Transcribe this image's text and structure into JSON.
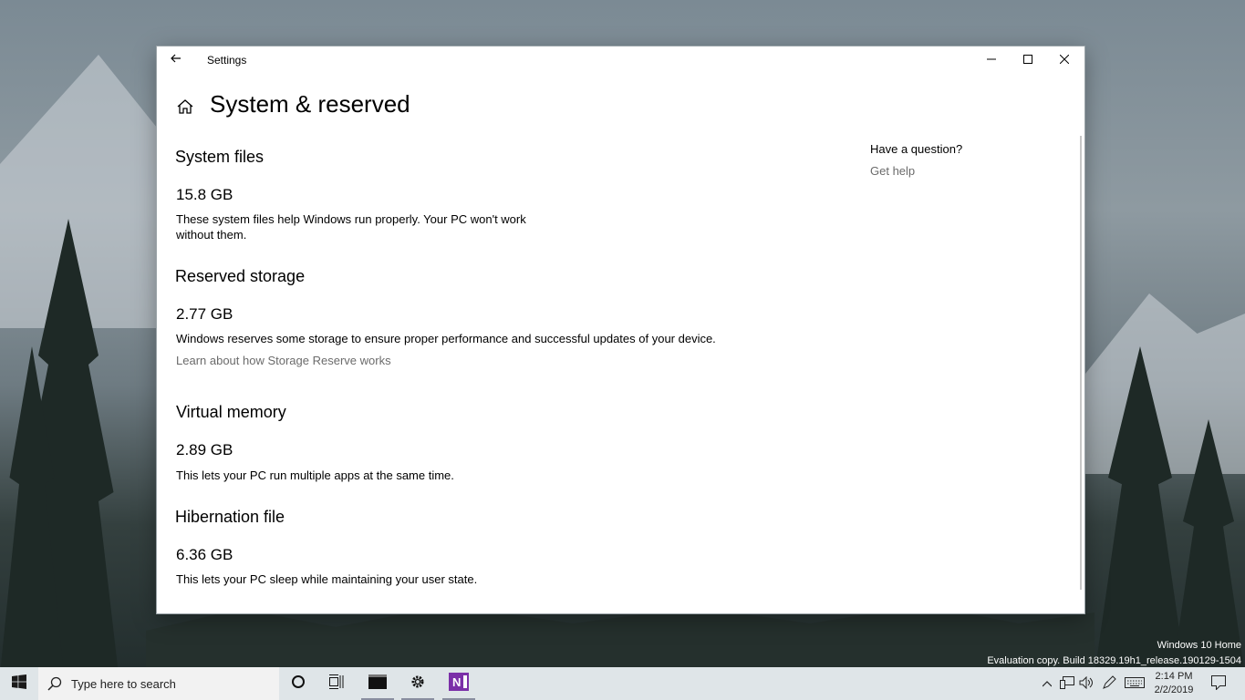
{
  "window": {
    "title": "Settings",
    "page_title": "System & reserved"
  },
  "sections": [
    {
      "heading": "System files",
      "size": "15.8 GB",
      "description": "These system files help Windows run properly. Your PC won't work without them."
    },
    {
      "heading": "Reserved storage",
      "size": "2.77 GB",
      "description": "Windows reserves some storage to ensure proper performance and successful updates of your device.",
      "link": "Learn about how Storage Reserve works"
    },
    {
      "heading": "Virtual memory",
      "size": "2.89 GB",
      "description": "This lets your PC run multiple apps at the same time."
    },
    {
      "heading": "Hibernation file",
      "size": "6.36 GB",
      "description": "This lets your PC sleep while maintaining your user state."
    }
  ],
  "aside": {
    "question": "Have a question?",
    "help_link": "Get help"
  },
  "desktop": {
    "watermark_line1": "Windows 10 Home",
    "watermark_line2": "Evaluation copy. Build 18329.19h1_release.190129-1504"
  },
  "taskbar": {
    "search_placeholder": "Type here to search",
    "time": "2:14 PM",
    "date": "2/2/2019",
    "apps": [
      "cortana-icon",
      "task-view-icon",
      "command-prompt-icon",
      "settings-gear-icon",
      "onenote-icon"
    ]
  },
  "colors": {
    "accent_link": "#6b6b6b",
    "onenote": "#7b2fa8",
    "taskbar": "#dfe5e8"
  }
}
